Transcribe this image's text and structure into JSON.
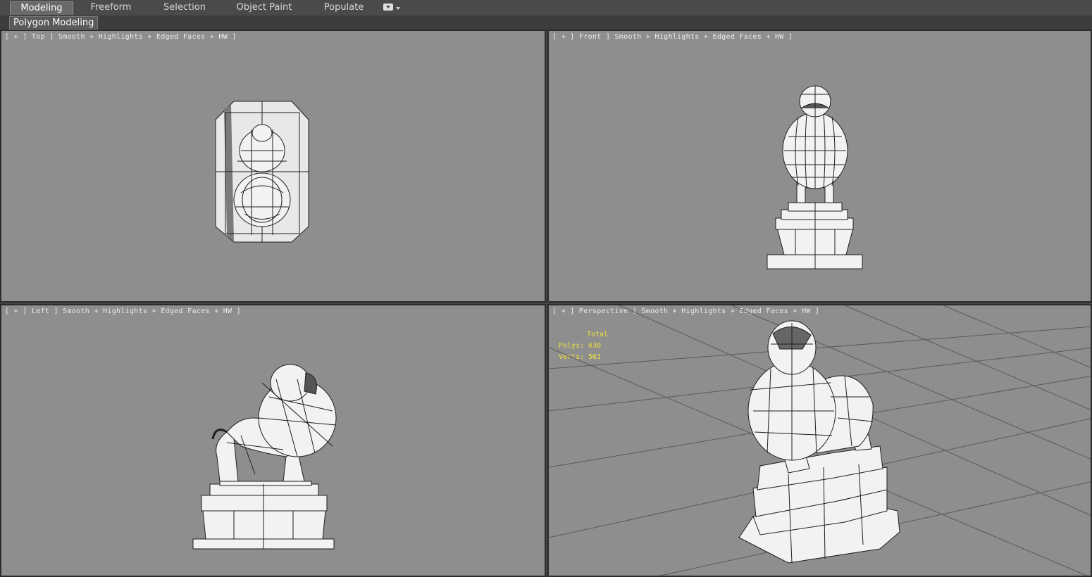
{
  "ribbon": {
    "tabs": [
      {
        "label": "Modeling",
        "active": true
      },
      {
        "label": "Freeform",
        "active": false
      },
      {
        "label": "Selection",
        "active": false
      },
      {
        "label": "Object Paint",
        "active": false
      },
      {
        "label": "Populate",
        "active": false
      }
    ],
    "extra_icon": "dropdown-menu-icon"
  },
  "subbar": {
    "panel_label": "Polygon Modeling"
  },
  "viewports": {
    "top": {
      "label": "[ + ] Top ] Smooth + Highlights + Edged Faces + HW ]"
    },
    "front": {
      "label": "[ + ] Front ] Smooth + Highlights + Edged Faces + HW ]"
    },
    "left": {
      "label": "[ + ] Left ] Smooth + Highlights + Edged Faces + HW ]"
    },
    "perspective": {
      "label": "[ + ] Perspective ] Smooth + Highlights + Edged Faces + HW ]",
      "stats": {
        "total_label": "Total",
        "polys": "Polys: 630",
        "verts": "Verts: 561"
      }
    }
  },
  "colors": {
    "viewport_bg": "#8e8e8e",
    "model_fill": "#f2f2f2",
    "wire": "#1e1e1e",
    "stats_text": "#f2e23a"
  }
}
